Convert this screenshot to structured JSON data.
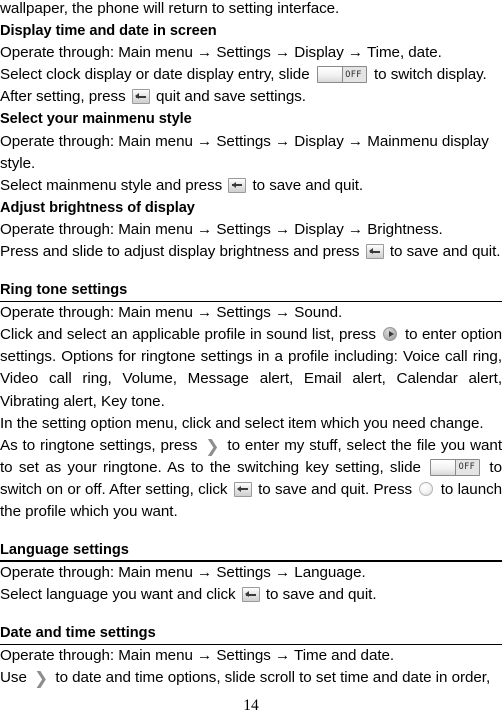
{
  "document": {
    "page_number": "14",
    "arrow": "→",
    "blocks": [
      {
        "id": "intro_continued",
        "type": "paragraph",
        "align": "left",
        "text": "wallpaper, the phone will return to setting interface."
      },
      {
        "id": "display_time_heading",
        "type": "heading",
        "text": "Display time and date in screen"
      },
      {
        "id": "display_time_path",
        "type": "paragraph",
        "align": "left",
        "text": "Operate through: Main menu → Settings → Display → Time, date."
      },
      {
        "id": "display_time_line1",
        "type": "paragraph_icon",
        "align": "left",
        "text_before": "Select clock display or date display entry, slide",
        "icon": "toggle-off-switch",
        "icon_label": "OFF",
        "text_after": "to switch display."
      },
      {
        "id": "display_time_line2",
        "type": "paragraph_icon",
        "align": "left",
        "text_before": "After setting, press",
        "icon": "back-key",
        "text_after": "quit and save settings."
      },
      {
        "id": "mainmenu_style_heading",
        "type": "heading",
        "text": "Select your mainmenu style"
      },
      {
        "id": "mainmenu_style_path",
        "type": "paragraph",
        "align": "left",
        "text": "Operate through: Main menu → Settings → Display → Mainmenu display style."
      },
      {
        "id": "mainmenu_style_line",
        "type": "paragraph_icon",
        "align": "left",
        "text_before": "Select mainmenu style and press",
        "icon": "back-key",
        "text_after": "to save and quit."
      },
      {
        "id": "brightness_heading",
        "type": "heading",
        "text": "Adjust brightness of display"
      },
      {
        "id": "brightness_path",
        "type": "paragraph",
        "align": "left",
        "text": "Operate through: Main menu → Settings → Display → Brightness."
      },
      {
        "id": "brightness_line",
        "type": "paragraph_icon",
        "align": "justify",
        "text_before": "Press and slide to adjust display brightness and press",
        "icon": "back-key",
        "text_after": "to save and quit."
      },
      {
        "id": "ringtone_heading",
        "type": "rule_heading",
        "text": "Ring tone settings"
      },
      {
        "id": "ringtone_path",
        "type": "paragraph",
        "align": "left",
        "text": "Operate through: Main menu → Settings → Sound."
      },
      {
        "id": "ringtone_options",
        "type": "paragraph_icon",
        "align": "justify",
        "text_before": "Click and select an applicable profile in sound list, press",
        "icon": "next-circle-key",
        "text_after": "to enter option settings. Options for ringtone settings in a profile including: Voice call ring, Video call ring, Volume, Message alert, Email alert, Calendar alert, Vibrating alert, Key tone."
      },
      {
        "id": "ringtone_setting_menu",
        "type": "paragraph",
        "align": "left",
        "text": "In the setting option menu, click and select item which you need change."
      },
      {
        "id": "ringtone_mystuff",
        "type": "paragraph_multi",
        "align": "justify",
        "segments": [
          {
            "kind": "text",
            "value": "As to ringtone settings, press"
          },
          {
            "kind": "icon",
            "value": "chevron-right"
          },
          {
            "kind": "text",
            "value": "to enter my stuff, select the file you want to set as your ringtone. As to the switching key setting, slide"
          },
          {
            "kind": "icon",
            "value": "toggle-off-switch"
          },
          {
            "kind": "text",
            "value": "to switch on or off. After setting, click"
          },
          {
            "kind": "icon",
            "value": "back-key"
          },
          {
            "kind": "text",
            "value": "to save and quit. Press"
          },
          {
            "kind": "icon",
            "value": "circle-key"
          },
          {
            "kind": "text",
            "value": "to launch the profile which you want."
          }
        ]
      },
      {
        "id": "language_heading",
        "type": "rule_heading",
        "text": "Language settings"
      },
      {
        "id": "language_path",
        "type": "paragraph",
        "align": "left",
        "text": "Operate through: Main menu → Settings → Language."
      },
      {
        "id": "language_line",
        "type": "paragraph_icon",
        "align": "left",
        "text_before": "Select language you want and click",
        "icon": "back-key",
        "text_after": "to save and quit."
      },
      {
        "id": "datetime_heading",
        "type": "rule_heading",
        "text": "Date and time settings"
      },
      {
        "id": "datetime_path",
        "type": "paragraph",
        "align": "left",
        "text": "Operate through: Main menu → Settings → Time and date."
      },
      {
        "id": "datetime_line",
        "type": "paragraph_icon",
        "align": "left",
        "text_before": "Use",
        "icon": "chevron-right",
        "text_after": "to date and time options, slide scroll to set time and date in order,"
      }
    ]
  }
}
